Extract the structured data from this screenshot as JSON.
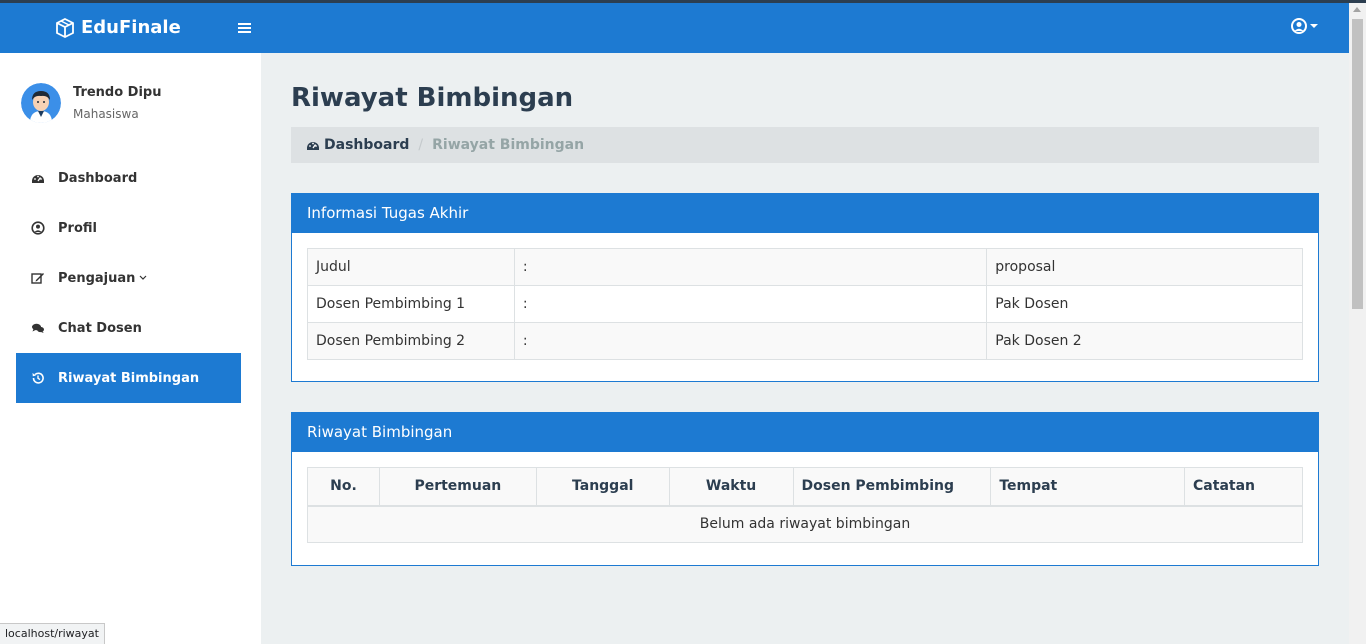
{
  "app": {
    "brand": "EduFinale"
  },
  "user": {
    "name": "Trendo Dipu",
    "role": "Mahasiswa"
  },
  "sidebar": {
    "items": [
      {
        "label": "Dashboard",
        "icon": "dashboard-icon"
      },
      {
        "label": "Profil",
        "icon": "user-circle-icon"
      },
      {
        "label": "Pengajuan",
        "icon": "edit-icon",
        "has_submenu": true
      },
      {
        "label": "Chat Dosen",
        "icon": "comments-icon"
      },
      {
        "label": "Riwayat Bimbingan",
        "icon": "history-icon",
        "active": true
      }
    ]
  },
  "page": {
    "title": "Riwayat Bimbingan"
  },
  "breadcrumb": {
    "home": "Dashboard",
    "separator": "/",
    "current": "Riwayat Bimbingan"
  },
  "info_panel": {
    "title": "Informasi Tugas Akhir",
    "rows": [
      {
        "label": "Judul",
        "sep": ":",
        "value": "proposal"
      },
      {
        "label": "Dosen Pembimbing 1",
        "sep": ":",
        "value": "Pak Dosen"
      },
      {
        "label": "Dosen Pembimbing 2",
        "sep": ":",
        "value": "Pak Dosen 2"
      }
    ]
  },
  "history_panel": {
    "title": "Riwayat Bimbingan",
    "columns": [
      "No.",
      "Pertemuan",
      "Tanggal",
      "Waktu",
      "Dosen Pembimbing",
      "Tempat",
      "Catatan"
    ],
    "empty_message": "Belum ada riwayat bimbingan"
  },
  "status_bar": {
    "url": "localhost/riwayat"
  },
  "colors": {
    "primary": "#1d7ad2",
    "dark": "#2c3e50",
    "background": "#ecf0f1"
  }
}
